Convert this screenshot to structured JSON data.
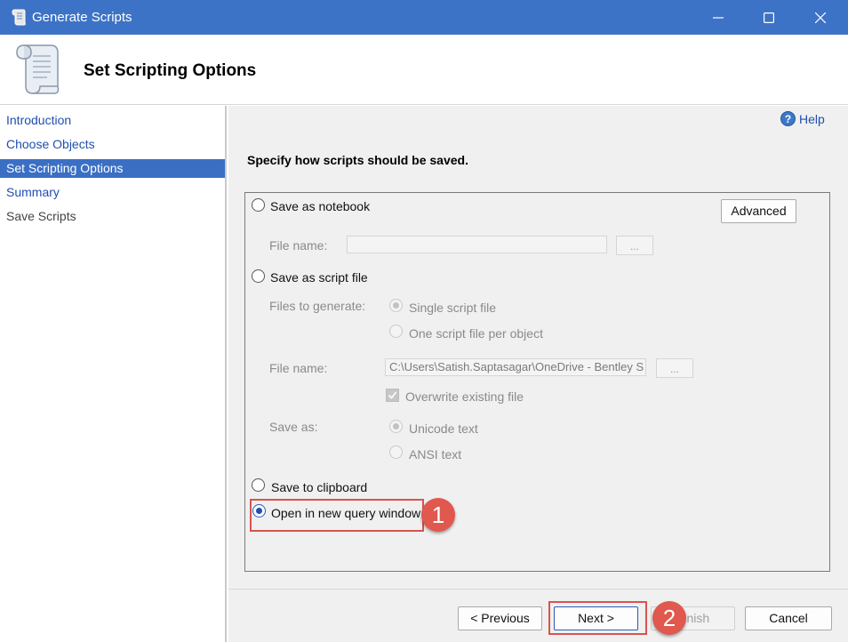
{
  "window": {
    "title": "Generate Scripts",
    "accent_color": "#3d73c6",
    "controls": [
      "minimize-icon",
      "maximize-icon",
      "close-icon"
    ]
  },
  "header": {
    "title": "Set Scripting Options",
    "icon": "scroll-icon"
  },
  "nav": {
    "items": [
      {
        "label": "Introduction",
        "state": "link"
      },
      {
        "label": "Choose Objects",
        "state": "link"
      },
      {
        "label": "Set Scripting Options",
        "state": "selected"
      },
      {
        "label": "Summary",
        "state": "link"
      },
      {
        "label": "Save Scripts",
        "state": "disabled"
      }
    ]
  },
  "main": {
    "help_label": "Help",
    "instruction": "Specify how scripts should be saved.",
    "notebook": {
      "label": "Save as notebook",
      "advanced_label": "Advanced",
      "file_name_label": "File name:",
      "file_name_value": "",
      "browse_label": "..."
    },
    "script_file": {
      "label": "Save as script file",
      "files_to_generate_label": "Files to generate:",
      "single_file_label": "Single script file",
      "one_per_object_label": "One script file per object",
      "file_name_label": "File name:",
      "file_name_value": "C:\\Users\\Satish.Saptasagar\\OneDrive - Bentley S",
      "browse_label": "...",
      "overwrite_label": "Overwrite existing file",
      "save_as_label": "Save as:",
      "unicode_label": "Unicode text",
      "ansi_label": "ANSI text"
    },
    "clipboard_label": "Save to clipboard",
    "query_window_label": "Open in new query window",
    "selected_option": "Open in new query window"
  },
  "footer": {
    "previous_label": "< Previous",
    "next_label": "Next >",
    "finish_label": "Finish",
    "cancel_label": "Cancel"
  },
  "annotations": {
    "step1": "1",
    "step2": "2",
    "highlight_color": "#d9534f"
  }
}
